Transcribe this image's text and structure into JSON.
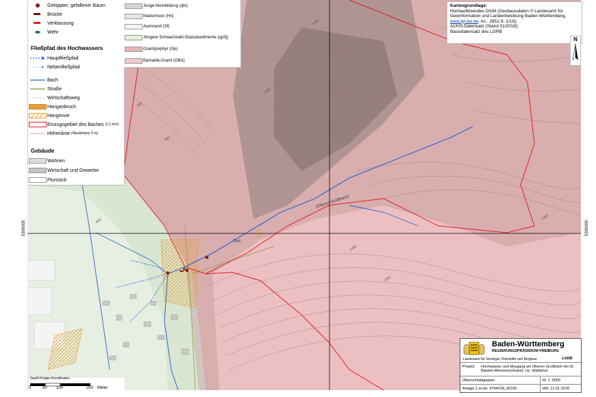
{
  "legend": {
    "symbols": [
      {
        "label": "Gekippter, gefallener Baum",
        "sym": "tree"
      },
      {
        "label": "Brücke",
        "sym": "bridge"
      },
      {
        "label": "Verklausung",
        "sym": "verkl"
      },
      {
        "label": "Wehr",
        "sym": "wehr"
      }
    ],
    "flow_title": "Fließpfad des Hochwassers",
    "flow": [
      {
        "label": "Hauptfließpfad",
        "sym": "main"
      },
      {
        "label": "Nebenfließpfad",
        "sym": "side"
      }
    ],
    "lines": [
      {
        "label": "Bach",
        "sym": "bach"
      },
      {
        "label": "Straße",
        "sym": "strasse"
      },
      {
        "label": "Wirtschaftsweg",
        "sym": "weg"
      },
      {
        "label": "Hanganbruch",
        "sym": "hangan"
      },
      {
        "label": "Hangmure",
        "sym": "mure"
      },
      {
        "label": "Einzugsgebiet des Baches",
        "note": "(1,1 km²)",
        "sym": "ezg"
      },
      {
        "label": "Höhenlinie",
        "note": "(Äquidistanz 5 m)",
        "sym": "hl"
      }
    ],
    "building_title": "Gebäude",
    "buildings": [
      {
        "label": "Wohnen",
        "color": "#dcdcdc"
      },
      {
        "label": "Wirtschaft und Gewerbe",
        "color": "#c4c4c4"
      },
      {
        "label": "Flurstück",
        "color": "#ffffff"
      }
    ],
    "geology": [
      {
        "label": "Junge Moorbildung (qht)",
        "color": "#d6d6d6"
      },
      {
        "label": "Niedermoor (Hn)",
        "color": "#e6e6e6"
      },
      {
        "label": "Auensand (Sf)",
        "color": "#f3f3f3"
      },
      {
        "label": "Jüngere Schwarzwald-Glazialsedimente (qpSj)",
        "color": "#e3f0dc"
      },
      {
        "label": "Granitporphyr (Gp)",
        "color": "#e7b6b9"
      },
      {
        "label": "Bärhalde-Granit (GBA)",
        "color": "#f2c9cb"
      }
    ]
  },
  "source": {
    "title": "Kartengrundlage:",
    "line1": "Hochauflösendes DGM (Geobasisdaten © Landesamt für",
    "line2": "Geoinformation und Landentwicklung Baden-Württemberg,",
    "link": "www.lgl-bw.de",
    "line3": ", Az.: 2851.9- 1/19);",
    "line4": "ALKIS-Datensatz (Stand 01/2018);",
    "line5": "Basisdatensatz des LGRB"
  },
  "north": "N",
  "coords": {
    "left": "5300000",
    "right": "5300000"
  },
  "map_labels": {
    "stream": "(Oberer Großbach)",
    "text": "Text",
    "contours": [
      "1000",
      "1050",
      "1100",
      "950",
      "900",
      "1150",
      "1200",
      "850"
    ]
  },
  "titlebox": {
    "state": "Baden-Württemberg",
    "rp": "REGIERUNGSPRÄSIDIUM FREIBURG",
    "lgrb_full": "Landesamt für Geologie, Rohstoffe und Bergbau",
    "lgrb": "LGRB",
    "projekt_label": "Projekt:",
    "projekt_text": "Hochwasser und Murgang am Oberen Großbach bei St. Blasien-Menzenschwand, Lkr. Waldshut",
    "plan": "Übersichtslageplan",
    "massstab": "M: 1 :5000",
    "anlage": "Anlage 1 zu Az. 4764//18_00195",
    "date": "Wd, 12.01.2018"
  },
  "scale": {
    "system": "Gauß-Krüger-Koordinaten",
    "ticks": [
      "0",
      "50",
      "100",
      "200"
    ],
    "unit": "Meter"
  },
  "colors": {
    "catchment": "#e02020",
    "stream": "#2a64c8",
    "granit": "#e7b6b9",
    "forest": "#cfd8c4"
  }
}
